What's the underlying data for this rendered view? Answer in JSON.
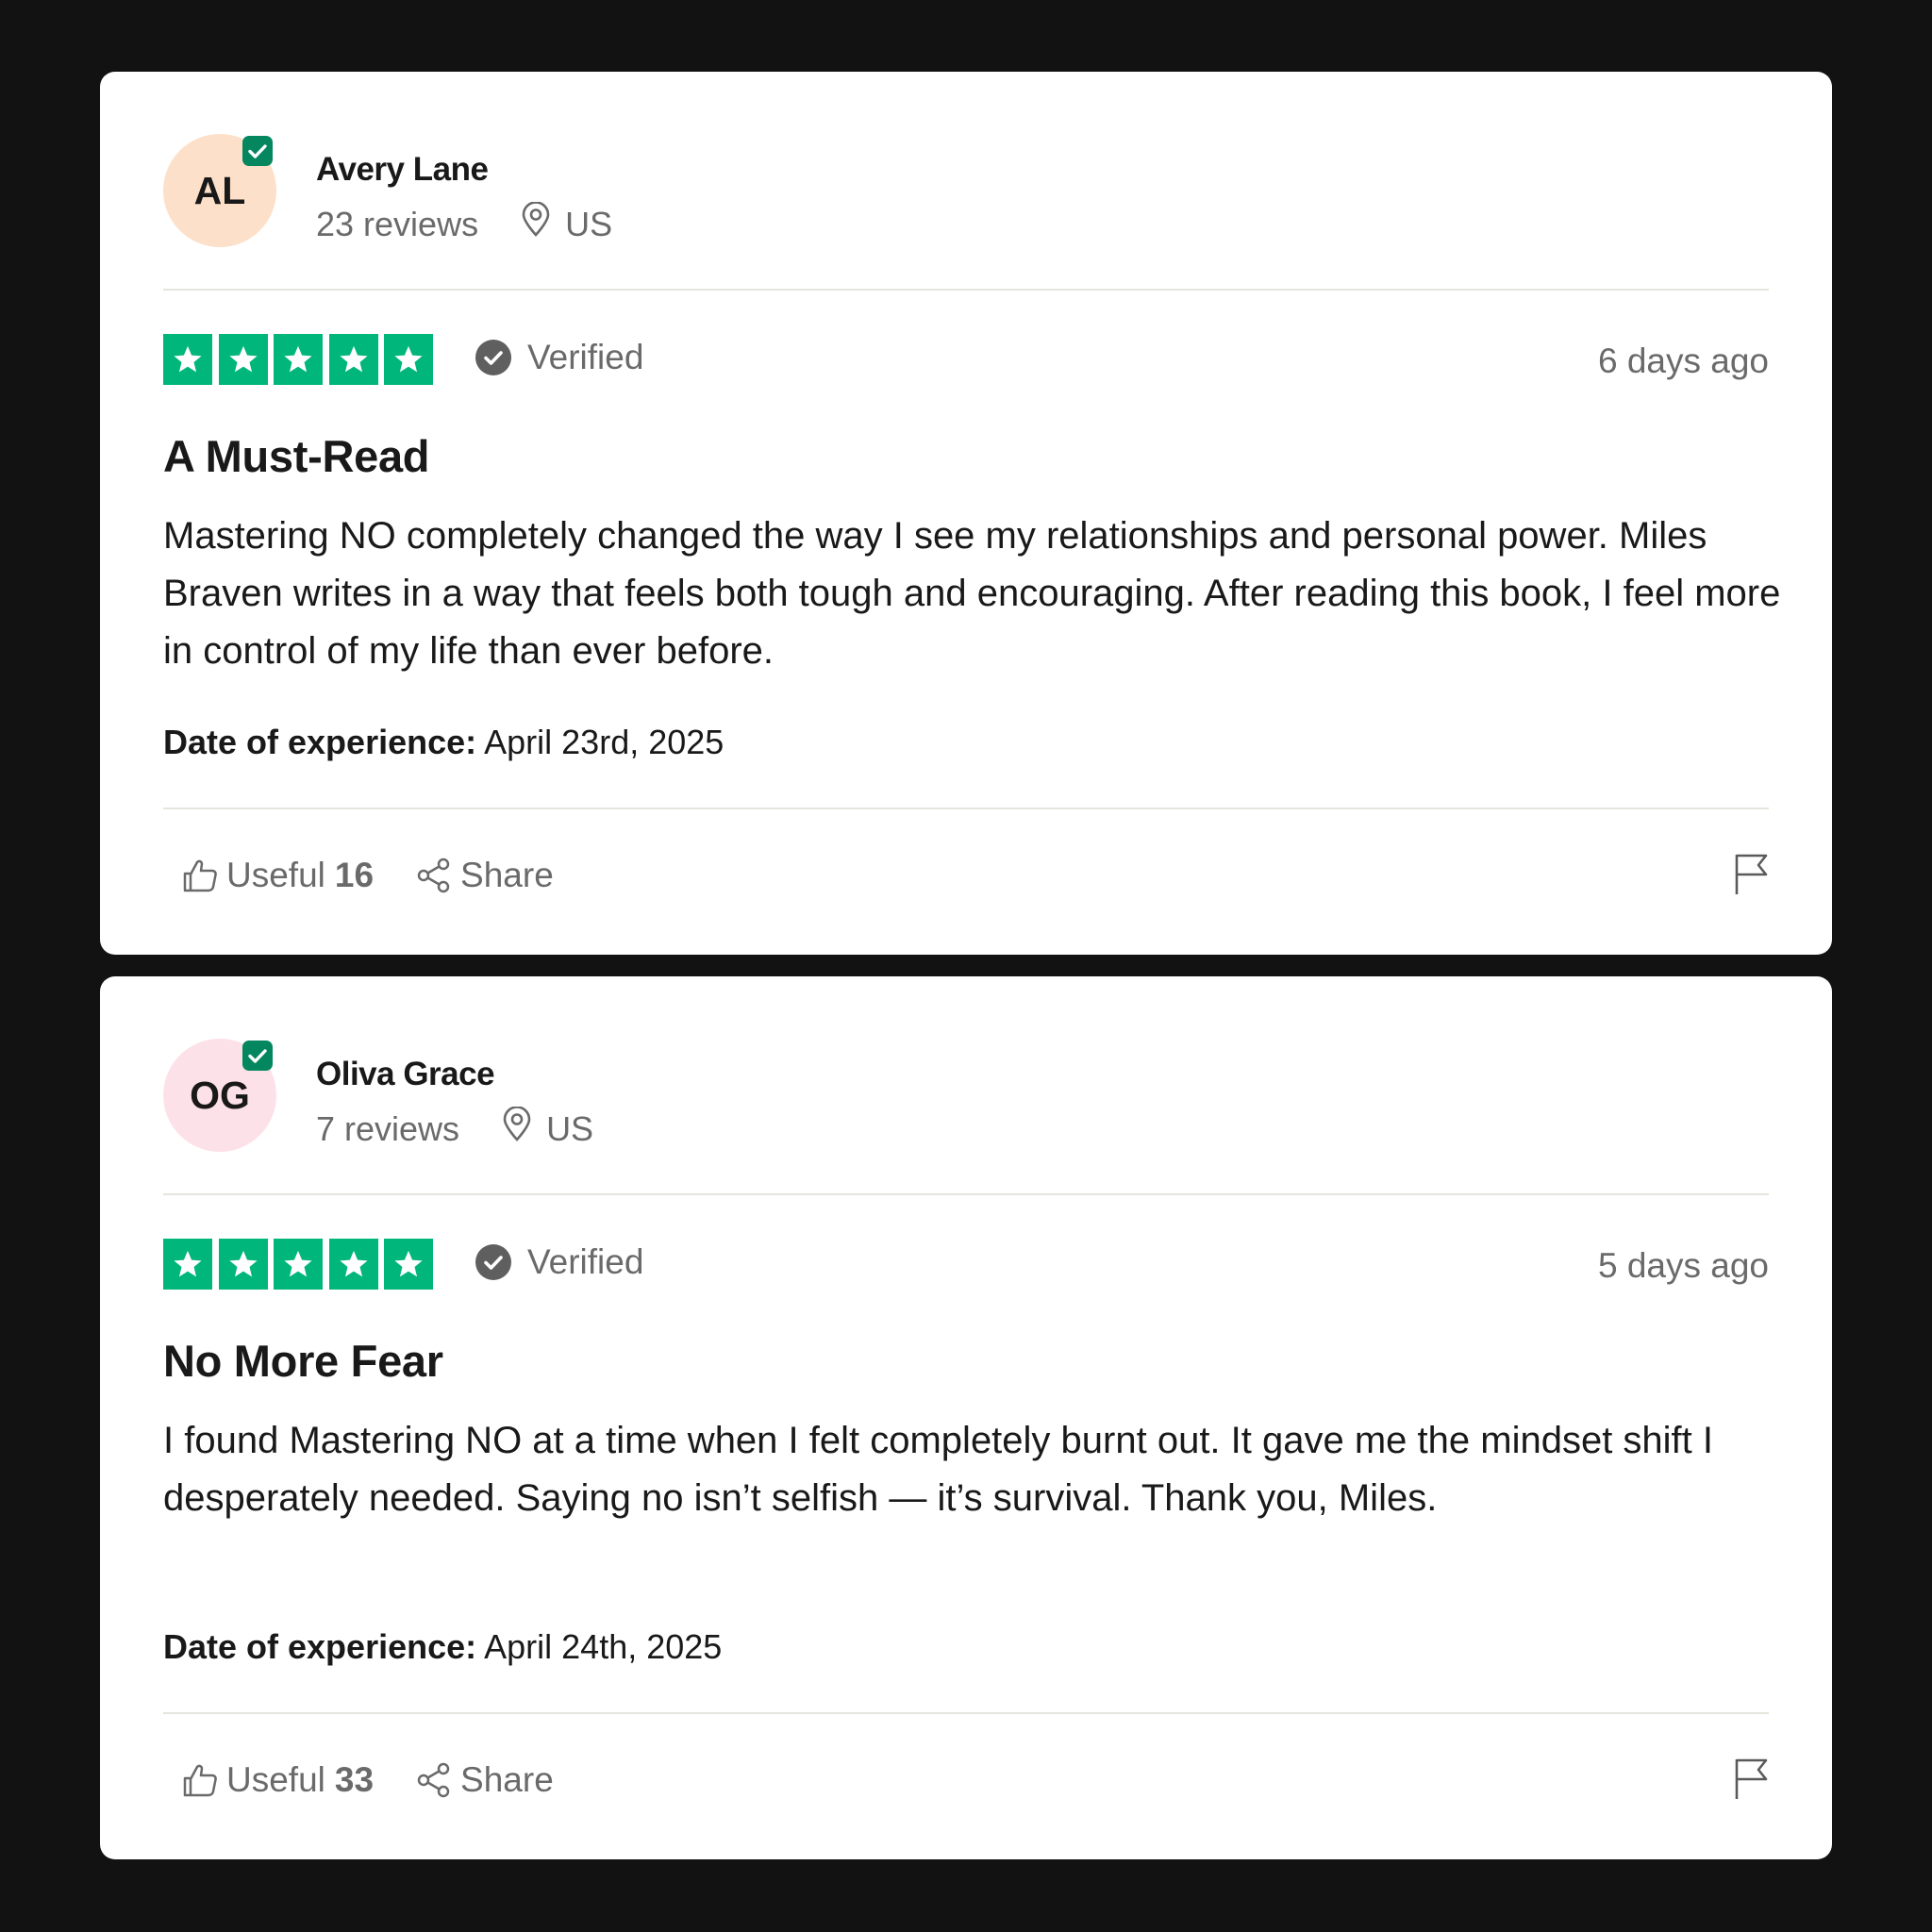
{
  "reviews": [
    {
      "initials": "AL",
      "avatar_color": "#fde0c9",
      "name": "Avery Lane",
      "review_count": "23 reviews",
      "country": "US",
      "stars": 5,
      "verified_label": "Verified",
      "time_ago": "6 days ago",
      "title": "A Must-Read",
      "body": "Mastering NO completely changed the way I see my relationships and personal power. Miles Braven writes in a way that feels both tough and encouraging. After reading this book, I feel more in control of my life than ever before.",
      "date_label": "Date of experience:",
      "date_value": "April 23rd, 2025",
      "useful_label": "Useful",
      "useful_count": "16",
      "share_label": "Share"
    },
    {
      "initials": "OG",
      "avatar_color": "#fde1e8",
      "name": "Oliva Grace",
      "review_count": "7 reviews",
      "country": "US",
      "stars": 5,
      "verified_label": "Verified",
      "time_ago": "5 days ago",
      "title": "No More Fear",
      "body": "I found Mastering NO at a time when I felt completely burnt out. It gave me the mindset shift I desperately needed. Saying no isn’t selfish — it’s survival. Thank you, Miles.",
      "date_label": "Date of experience:",
      "date_value": "April 24th, 2025",
      "useful_label": "Useful",
      "useful_count": "33",
      "share_label": "Share"
    }
  ],
  "colors": {
    "background": "#121212",
    "card": "#ffffff",
    "star_green": "#00b67a",
    "badge_green": "#04875e",
    "muted_text": "#6a6a6a",
    "text": "#191919"
  },
  "icons": {
    "location": "location-pin-icon",
    "verified": "check-circle-icon",
    "useful": "thumbs-up-icon",
    "share": "share-icon",
    "report": "flag-icon",
    "star": "star-icon"
  }
}
